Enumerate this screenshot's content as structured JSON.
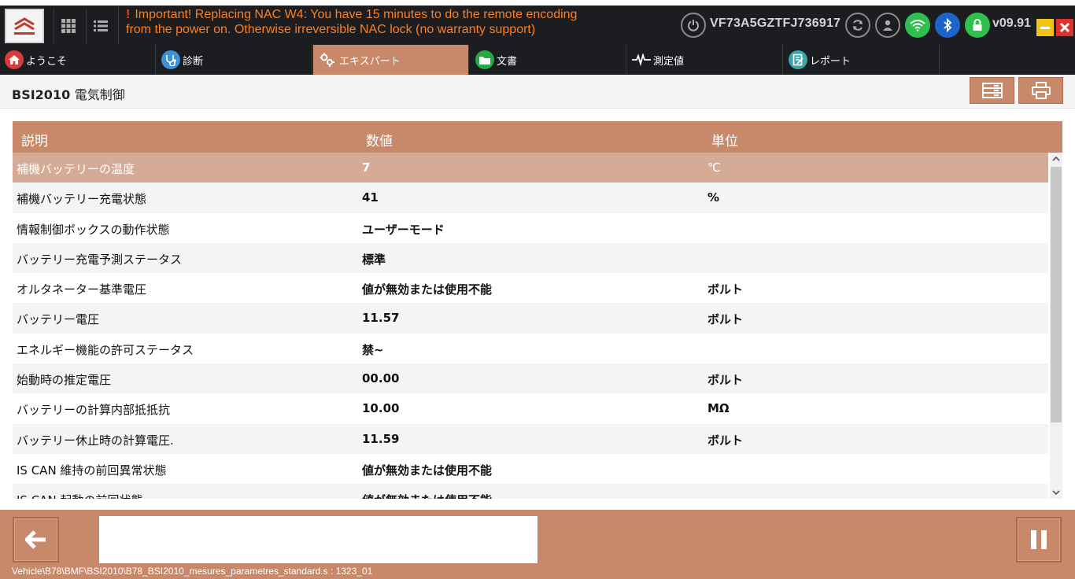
{
  "header": {
    "warning_line1": "Important! Replacing NAC W4: You have 15 minutes to do the remote encoding",
    "warning_line2": "from the power on. Otherwise irreversible NAC lock (no warranty support)",
    "warning_mark": "!",
    "vin": "VF73A5GZTFJ736917",
    "version": "v09.91"
  },
  "tabs": [
    {
      "label": "ようこそ",
      "icon": "home-icon",
      "color": "#d63c3c"
    },
    {
      "label": "診断",
      "icon": "stethoscope-icon",
      "color": "#3d8fd6"
    },
    {
      "label": "エキスパート",
      "icon": "gears-icon",
      "color": "#c8896a"
    },
    {
      "label": "文書",
      "icon": "folder-icon",
      "color": "#27a844"
    },
    {
      "label": "測定値",
      "icon": "waveform-icon",
      "color": "#555555"
    },
    {
      "label": "レポート",
      "icon": "report-icon",
      "color": "#3aa6a8"
    }
  ],
  "page": {
    "title_code": "BSI2010",
    "title_text": "電気制御"
  },
  "table": {
    "headers": [
      "説明",
      "数値",
      "単位"
    ],
    "rows": [
      {
        "desc": "補機バッテリーの温度",
        "value": "7",
        "unit": "℃"
      },
      {
        "desc": "補機バッテリー充電状態",
        "value": "41",
        "unit": "%"
      },
      {
        "desc": "情報制御ボックスの動作状態",
        "value": "ユーザーモード",
        "unit": ""
      },
      {
        "desc": "バッテリー充電予測ステータス",
        "value": "標準",
        "unit": ""
      },
      {
        "desc": "オルタネーター基準電圧",
        "value": "値が無効または使用不能",
        "unit": "ボルト"
      },
      {
        "desc": "バッテリー電圧",
        "value": "11.57",
        "unit": "ボルト"
      },
      {
        "desc": "エネルギー機能の許可ステータス",
        "value": "禁~",
        "unit": ""
      },
      {
        "desc": "始動時の推定電圧",
        "value": "00.00",
        "unit": "ボルト"
      },
      {
        "desc": "バッテリーの計算内部抵抵抗",
        "value": "10.00",
        "unit": "MΩ"
      },
      {
        "desc": "バッテリー休止時の計算電圧.",
        "value": "11.59",
        "unit": "ボルト"
      },
      {
        "desc": "IS CAN 維持の前回異常状態",
        "value": "値が無効または使用不能",
        "unit": ""
      },
      {
        "desc": "IS CAN 起動の前回状態",
        "value": "値が無効または使用不能",
        "unit": ""
      }
    ]
  },
  "footer": {
    "path": "Vehicle\\B78\\BMF\\BSI2010\\B78_BSI2010_mesures_parametres_standard.s : 1323_01",
    "message": ""
  },
  "colors": {
    "accent": "#c8896a",
    "dark_bar": "#1b1d20",
    "warning": "#ff7f1f",
    "selected_row": "#d6ab96"
  }
}
